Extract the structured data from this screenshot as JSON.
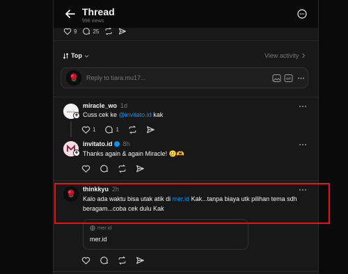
{
  "header": {
    "title": "Thread",
    "views": "996 views"
  },
  "previous_post": {
    "likes": "9",
    "comments": "25"
  },
  "sort": {
    "label": "Top",
    "view_activity": "View activity"
  },
  "reply_box": {
    "placeholder": "Reply to tiara.mu17..."
  },
  "comments": [
    {
      "username": "miracle_wo",
      "time": "1d",
      "text_before": "Cuss cek ke ",
      "mention": "@invitato.id",
      "text_after": " kak",
      "likes": "1",
      "replies": "1"
    },
    {
      "username": "invitato.id",
      "verified": true,
      "time": "8h",
      "text": "Thanks again & again Miracle! 🥲🫶"
    },
    {
      "username": "thinkkyu",
      "time": "2h",
      "text_before": "Kalo ada waktu bisa utak atik di ",
      "mention": "mer.id",
      "text_after": " Kak...tanpa biaya utk pilihan tema sdh beragam...coba cek dulu Kak",
      "link_card": {
        "domain": "mer.id",
        "title": "mer.id"
      }
    }
  ],
  "colors": {
    "accent_link": "#0095f6",
    "highlight_box": "#e8101b",
    "panel_bg": "#181818",
    "page_bg": "#0a0a0a"
  },
  "icons": [
    "back-arrow-icon",
    "more-circle-icon",
    "heart-icon",
    "comment-icon",
    "repost-icon",
    "share-icon",
    "sort-icon",
    "chevron-down-icon",
    "chevron-right-icon",
    "image-icon",
    "gif-icon",
    "more-dots-icon",
    "globe-icon"
  ]
}
